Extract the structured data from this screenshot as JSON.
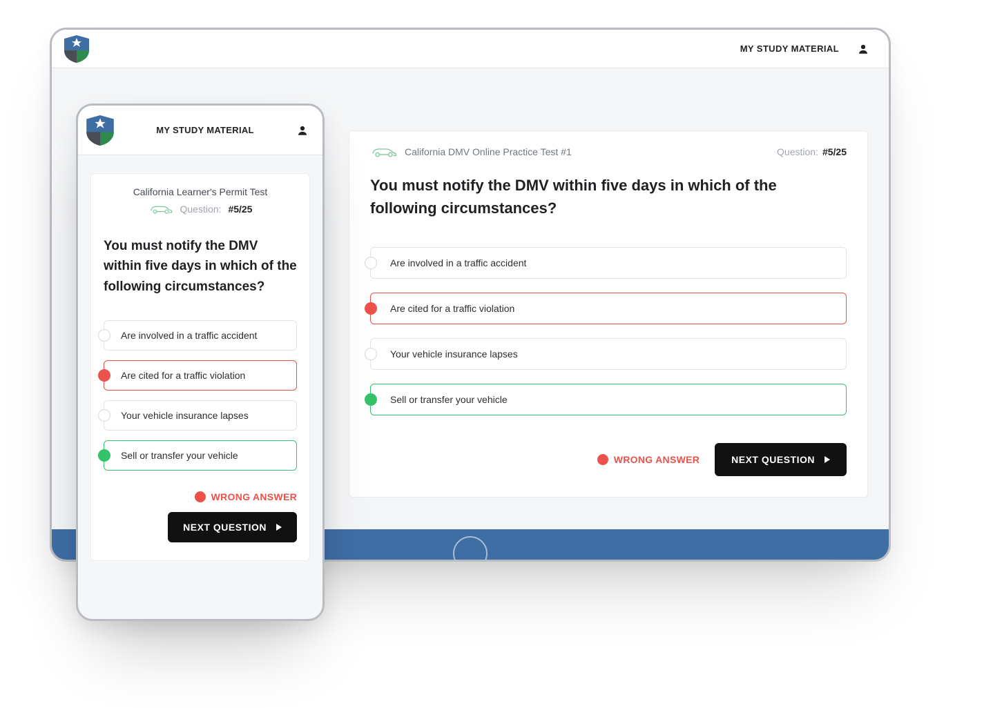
{
  "nav": {
    "study_link": "MY STUDY MATERIAL"
  },
  "desktop": {
    "test_title": "California DMV Online Practice Test #1",
    "question_label": "Question:",
    "question_count": "#5/25",
    "question_text": "You must notify the DMV within five days in which of the following circumstances?",
    "options": [
      "Are involved in a traffic accident",
      "Are cited for a traffic violation",
      "Your vehicle insurance lapses",
      "Sell or transfer your vehicle"
    ],
    "wrong_label": "WRONG ANSWER",
    "next_label": "NEXT QUESTION"
  },
  "mobile": {
    "test_title": "California Learner's Permit Test",
    "question_label": "Question:",
    "question_count": "#5/25",
    "question_text": "You must notify the DMV within five days in which of the following circumstances?",
    "options": [
      "Are involved in a traffic accident",
      "Are cited for a traffic violation",
      "Your vehicle insurance lapses",
      "Sell or transfer your vehicle"
    ],
    "wrong_label": "WRONG ANSWER",
    "next_label": "NEXT QUESTION"
  }
}
